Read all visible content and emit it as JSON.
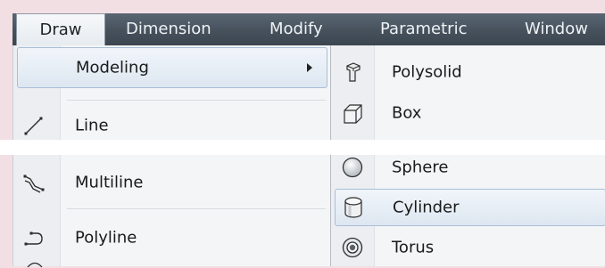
{
  "menubar": {
    "items": [
      {
        "label": "Draw",
        "state": "open"
      },
      {
        "label": "Dimension"
      },
      {
        "label": "Modify"
      },
      {
        "label": "Parametric"
      },
      {
        "label": "Window"
      }
    ]
  },
  "draw_menu": {
    "items": [
      {
        "label": "Modeling",
        "icon": "none",
        "submenu": true,
        "highlighted": true
      },
      {
        "label": "Line",
        "icon": "line-icon"
      },
      {
        "label": "Multiline",
        "icon": "multiline-icon"
      },
      {
        "label": "Polyline",
        "icon": "polyline-icon"
      }
    ]
  },
  "modeling_submenu": {
    "items": [
      {
        "label": "Polysolid",
        "icon": "polysolid-icon"
      },
      {
        "label": "Box",
        "icon": "box-icon"
      },
      {
        "label": "Sphere",
        "icon": "sphere-icon"
      },
      {
        "label": "Cylinder",
        "icon": "cylinder-icon",
        "highlighted": true
      },
      {
        "label": "Torus",
        "icon": "torus-icon"
      }
    ]
  },
  "colors": {
    "menubar_bg": "#46515c",
    "menu_bg": "#f4f5f7",
    "highlight_border": "#a9bfd6",
    "page_bg": "#f2dfe4"
  }
}
